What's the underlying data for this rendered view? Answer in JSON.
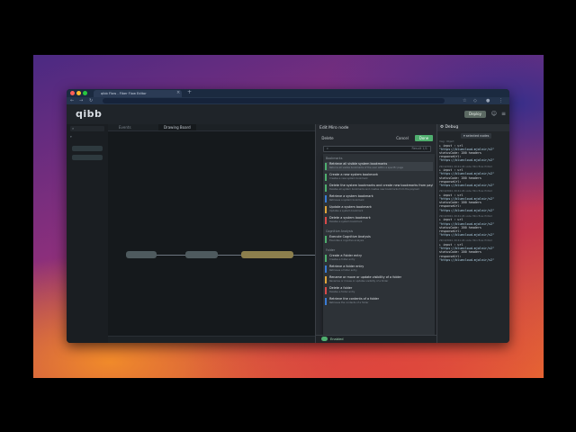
{
  "browser": {
    "tab_title": "qibb Flow - Fiber Flow Editor",
    "tab_close": "×",
    "tab_add": "+",
    "url": "",
    "nav_back": "←",
    "nav_forward": "→",
    "nav_reload": "↻"
  },
  "app": {
    "logo": "qibb",
    "deploy_label": "Deploy",
    "menu_icon": "≡",
    "user_icon": "☺"
  },
  "workspace": {
    "tabs": [
      "Events",
      "Drawing Board"
    ],
    "nodes": [
      {
        "label": "",
        "color": "#6b7a7f"
      },
      {
        "label": "",
        "color": "#6b7a7f"
      },
      {
        "label": "",
        "color": "#b9a765"
      }
    ]
  },
  "edit_tray": {
    "title": "Edit Miro node",
    "delete_label": "Delete",
    "cancel_label": "Cancel",
    "done_label": "Done",
    "search_placeholder": "c",
    "search_count": "Result 1/1",
    "groups": [
      {
        "name": "Bookmarks",
        "items": [
          {
            "title": "Retrieve all visible system bookmarks",
            "desc": "Returns all visible bookmarks of the user within a specific page",
            "color": "#4fae6e",
            "highlight": true
          },
          {
            "title": "Create a new system bookmark",
            "desc": "Creates a new system bookmark",
            "color": "#4fae6e"
          },
          {
            "title": "Delete the system bookmarks and create new bookmarks from payload",
            "desc": "Deletes all system bookmarks and creates new bookmarks from the payload",
            "color": "#4fae6e"
          },
          {
            "title": "Retrieve a system bookmark",
            "desc": "Retrieves a system bookmark",
            "color": "#3a7bd5"
          },
          {
            "title": "Update a system bookmark",
            "desc": "Updates a system bookmark",
            "color": "#e0a53a"
          },
          {
            "title": "Delete a system bookmark",
            "desc": "Deletes a system bookmark",
            "color": "#d94a4a"
          }
        ]
      },
      {
        "name": "Cognitive Analysis",
        "items": [
          {
            "title": "Execute Cognitive Analysis",
            "desc": "Executes a cognitive analysis",
            "color": "#4fae6e"
          }
        ]
      },
      {
        "name": "Folder",
        "items": [
          {
            "title": "Create a Folder entry",
            "desc": "Creates a folder entry",
            "color": "#4fae6e"
          },
          {
            "title": "Retrieve a folder entry",
            "desc": "Retrieves a folder entry",
            "color": "#3a7bd5"
          },
          {
            "title": "Rename or move or update visibility of a folder",
            "desc": "Renames or moves or updates visibility of a folder",
            "color": "#e0a53a"
          },
          {
            "title": "Delete a folder",
            "desc": "Deletes a folder entry",
            "color": "#d94a4a"
          },
          {
            "title": "Retrieve the contents of a folder",
            "desc": "Retrieves the contents of a folder",
            "color": "#3a7bd5"
          }
        ]
      }
    ],
    "footer_status": "Enabled"
  },
  "debug": {
    "title": "Debug",
    "filter_label": "selected nodes",
    "messages": [
      {
        "meta": "msg : Object",
        "lines": [
          "▸ input : url",
          "\"https://bluecloud.mjolnir/v2\"",
          "statusCode: 200  headers",
          "responseUrl:",
          "\"https://bluecloud.mjolnir/v2\""
        ]
      },
      {
        "meta": "29/10/2024, 00:41:26  node: Miro flow: Pritoid",
        "lines": [
          "▸ input : url",
          "\"https://bluecloud.mjolnir/v2\"",
          "statusCode: 200  headers",
          "responseUrl:",
          "\"https://bluecloud.mjolnir/v2\""
        ]
      },
      {
        "meta": "29/10/2024, 00:41:26  node: Miro flow: Pritoid",
        "lines": [
          "▸ input : url",
          "\"https://bluecloud.mjolnir/v2\"",
          "statusCode: 200  headers",
          "responseUrl:",
          "\"https://bluecloud.mjolnir/v2\""
        ]
      },
      {
        "meta": "29/10/2024, 00:41:26  node: Miro flow: Pritoid",
        "lines": [
          "▸ input : url",
          "\"https://bluecloud.mjolnir/v2\"",
          "statusCode: 200  headers",
          "responseUrl:",
          "\"https://bluecloud.mjolnir/v2\""
        ]
      },
      {
        "meta": "29/10/2024, 00:41:26  node: Miro flow: Pritoid",
        "lines": [
          "▸ input : url",
          "\"https://bluecloud.mjolnir/v2\"",
          "statusCode: 200  headers",
          "responseUrl:",
          "\"https://bluecloud.mjolnir/v2\""
        ]
      }
    ]
  }
}
